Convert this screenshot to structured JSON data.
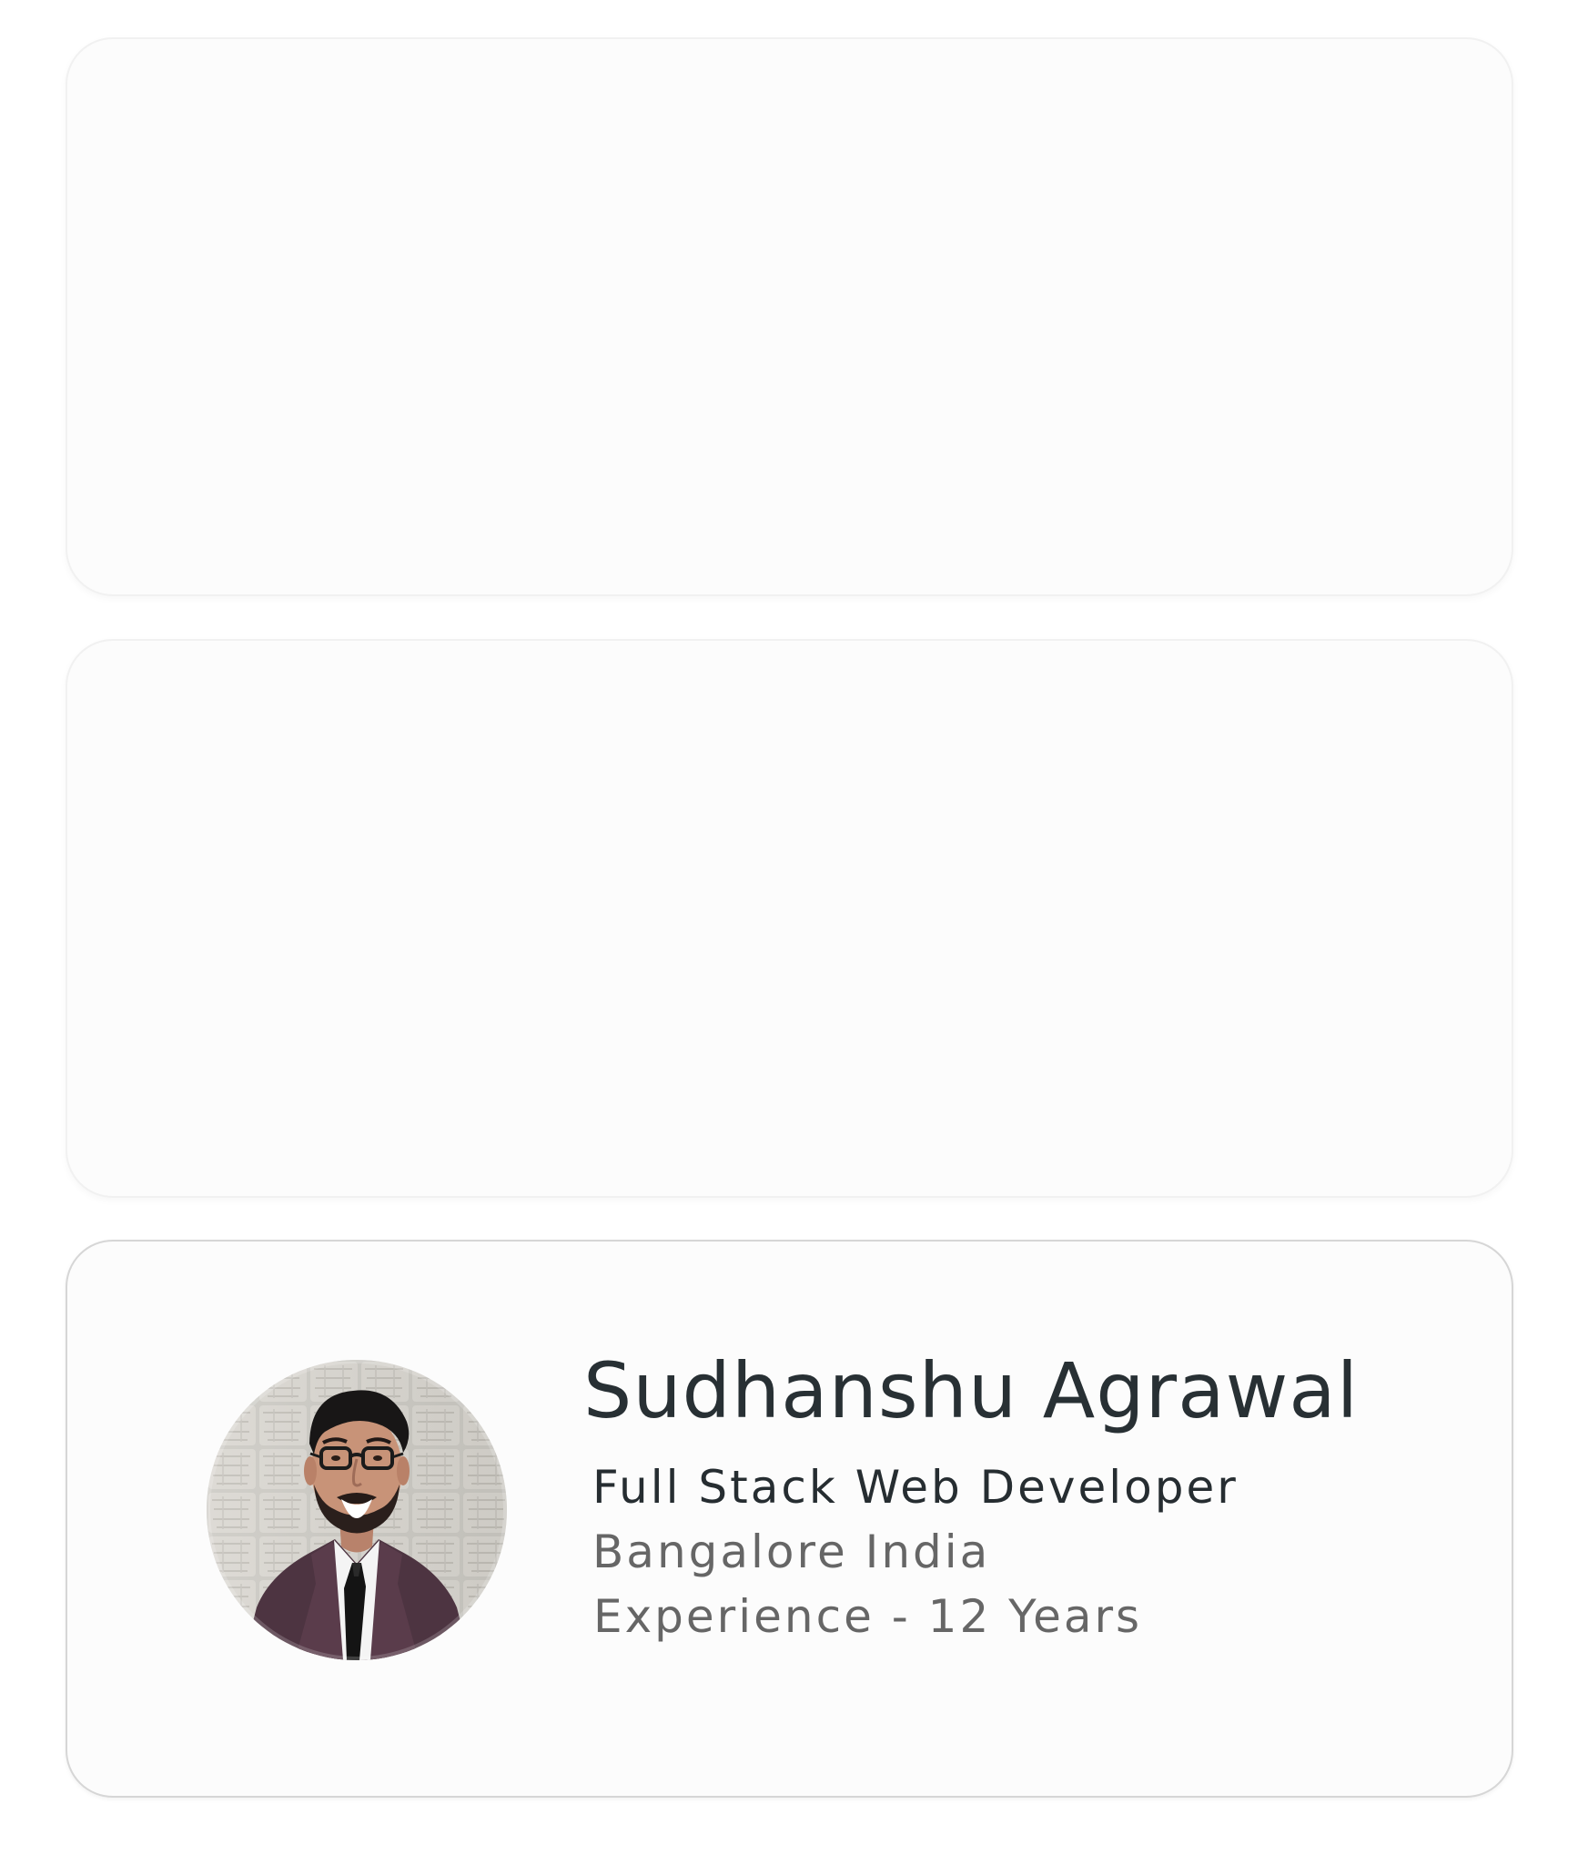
{
  "profile": {
    "name": "Sudhanshu Agrawal",
    "role": "Full Stack Web Developer",
    "location": "Bangalore India",
    "experience": "Experience - 12 Years"
  },
  "colors": {
    "card_background": "#fcfcfc",
    "card_border": "#f1f1f1",
    "profile_card_border": "#d6d6d6",
    "name_text": "#283034",
    "role_text": "#262d31",
    "secondary_text": "#666666"
  },
  "icons": {
    "avatar": "profile-photo"
  }
}
